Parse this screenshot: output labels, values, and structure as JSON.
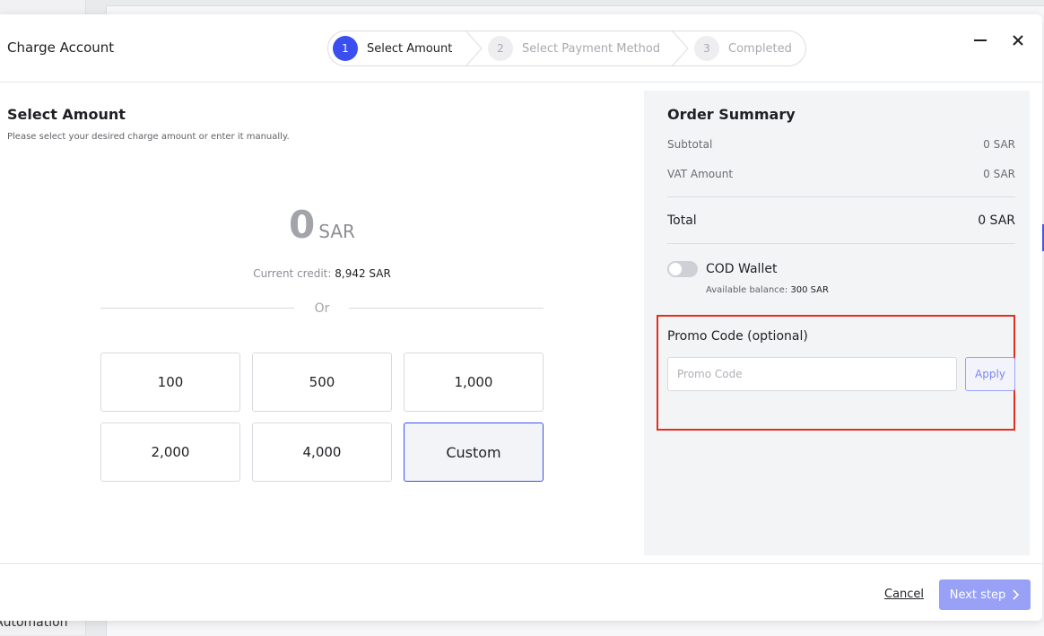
{
  "background": {
    "fragment_text": "Automation"
  },
  "modal": {
    "title": "Charge Account"
  },
  "stepper": {
    "steps": [
      {
        "number": "1",
        "label": "Select Amount"
      },
      {
        "number": "2",
        "label": "Select Payment Method"
      },
      {
        "number": "3",
        "label": "Completed"
      }
    ],
    "active_color": "#3b4ff0"
  },
  "header_icons": {
    "minimize": "minimize-icon",
    "close": "close-icon"
  },
  "select_amount": {
    "title": "Select Amount",
    "description": "Please select your desired charge amount or enter it manually.",
    "amount_value": "0",
    "currency": "SAR",
    "credit_label": "Current credit:",
    "credit_value": "8,942 SAR",
    "or_text": "Or",
    "options": [
      "100",
      "500",
      "1,000",
      "2,000",
      "4,000",
      "Custom"
    ],
    "selected_option": "Custom"
  },
  "order_summary": {
    "title": "Order Summary",
    "subtotal_label": "Subtotal",
    "subtotal_value": "0 SAR",
    "vat_label": "VAT Amount",
    "vat_value": "0 SAR",
    "total_label": "Total",
    "total_value": "0 SAR",
    "cod_wallet_label": "COD Wallet",
    "cod_wallet_enabled": false,
    "available_balance_label": "Available balance:",
    "available_balance_value": "300 SAR",
    "promo_label": "Promo Code (optional)",
    "promo_placeholder": "Promo Code",
    "promo_value": "",
    "apply_label": "Apply"
  },
  "footer": {
    "cancel_label": "Cancel",
    "next_label": "Next step"
  },
  "colors": {
    "accent": "#3b4ff0",
    "highlight": "#e52e1f",
    "next_button": "#98a1f6"
  }
}
